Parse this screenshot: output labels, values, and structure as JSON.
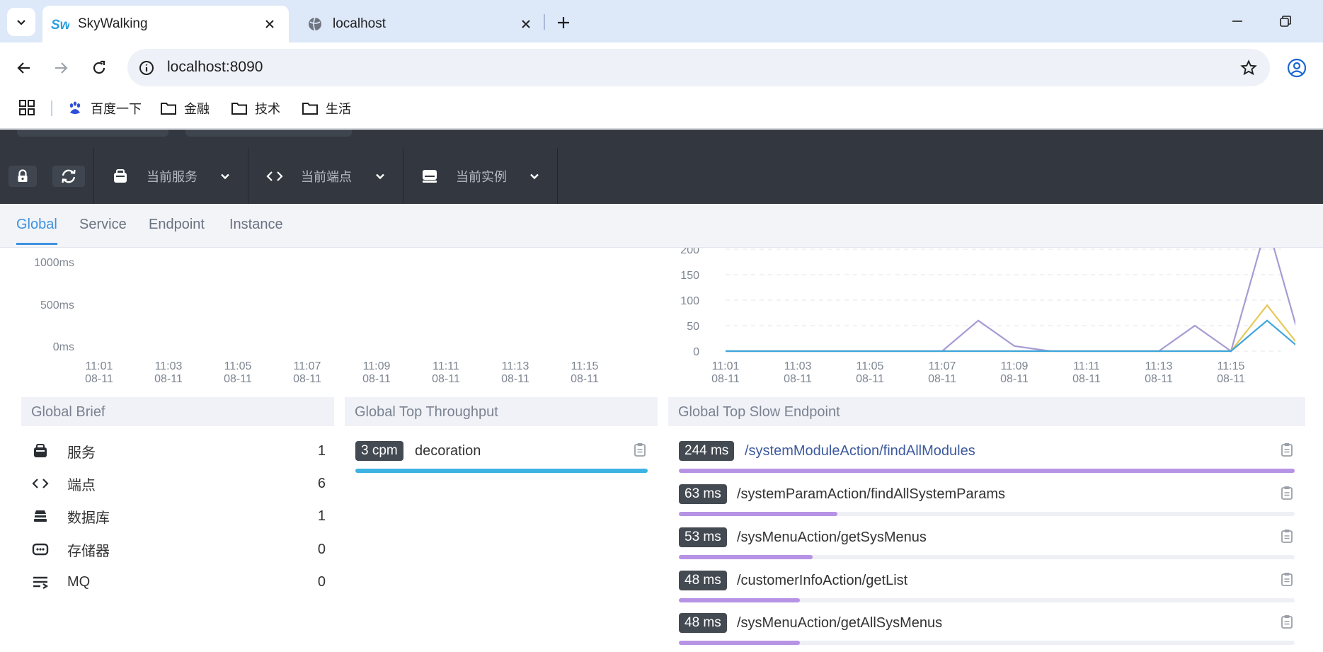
{
  "browser": {
    "tabs": [
      {
        "title": "SkyWalking",
        "active": true
      },
      {
        "title": "localhost",
        "active": false
      }
    ],
    "url": "localhost:8090",
    "bookmarks": [
      "百度一下",
      "金融",
      "技术",
      "生活"
    ]
  },
  "app": {
    "selectors": {
      "service": "当前服务",
      "endpoint": "当前端点",
      "instance": "当前实例"
    },
    "tabs": [
      "Global",
      "Service",
      "Endpoint",
      "Instance"
    ],
    "active_tab": "Global"
  },
  "chart_data": [
    {
      "type": "line",
      "title": "",
      "x": [
        "11:01\n08-11",
        "11:03\n08-11",
        "11:05\n08-11",
        "11:07\n08-11",
        "11:09\n08-11",
        "11:11\n08-11",
        "11:13\n08-11",
        "11:15\n08-11"
      ],
      "y_ticks": [
        "1000ms",
        "500ms",
        "0ms"
      ],
      "series": []
    },
    {
      "type": "line",
      "title": "",
      "x": [
        "11:01\n08-11",
        "11:03\n08-11",
        "11:05\n08-11",
        "11:07\n08-11",
        "11:09\n08-11",
        "11:11\n08-11",
        "11:13\n08-11",
        "11:15\n08-11"
      ],
      "y_ticks": [
        "200",
        "150",
        "100",
        "50",
        "0"
      ],
      "series": [
        {
          "color": "#a89bd3",
          "values": [
            0,
            0,
            0,
            0,
            0,
            0,
            0,
            60,
            10,
            0,
            0,
            0,
            0,
            50,
            0,
            250,
            0
          ]
        },
        {
          "color": "#e7c85a",
          "values": [
            0,
            0,
            0,
            0,
            0,
            0,
            0,
            0,
            0,
            0,
            0,
            0,
            0,
            0,
            0,
            90,
            0
          ]
        },
        {
          "color": "#3ea6de",
          "values": [
            0,
            0,
            0,
            0,
            0,
            0,
            0,
            0,
            0,
            0,
            0,
            0,
            0,
            0,
            0,
            60,
            0
          ]
        }
      ]
    }
  ],
  "global_brief": {
    "title": "Global Brief",
    "items": [
      {
        "label": "服务",
        "value": "1",
        "icon": "service-icon"
      },
      {
        "label": "端点",
        "value": "6",
        "icon": "endpoint-icon"
      },
      {
        "label": "数据库",
        "value": "1",
        "icon": "database-icon"
      },
      {
        "label": "存储器",
        "value": "0",
        "icon": "cache-icon"
      },
      {
        "label": "MQ",
        "value": "0",
        "icon": "mq-icon"
      }
    ]
  },
  "top_throughput": {
    "title": "Global Top Throughput",
    "items": [
      {
        "badge": "3 cpm",
        "label": "decoration",
        "fraction": 1.0,
        "color": "#3db3e3"
      }
    ]
  },
  "top_slow": {
    "title": "Global Top Slow Endpoint",
    "items": [
      {
        "badge": "244 ms",
        "label": "/systemModuleAction/findAllModules",
        "fraction": 1.0,
        "color": "#b793e5"
      },
      {
        "badge": "63 ms",
        "label": "/systemParamAction/findAllSystemParams",
        "fraction": 0.258,
        "color": "#b793e5"
      },
      {
        "badge": "53 ms",
        "label": "/sysMenuAction/getSysMenus",
        "fraction": 0.217,
        "color": "#b793e5"
      },
      {
        "badge": "48 ms",
        "label": "/customerInfoAction/getList",
        "fraction": 0.197,
        "color": "#b793e5"
      },
      {
        "badge": "48 ms",
        "label": "/sysMenuAction/getAllSysMenus",
        "fraction": 0.197,
        "color": "#b793e5"
      }
    ]
  }
}
